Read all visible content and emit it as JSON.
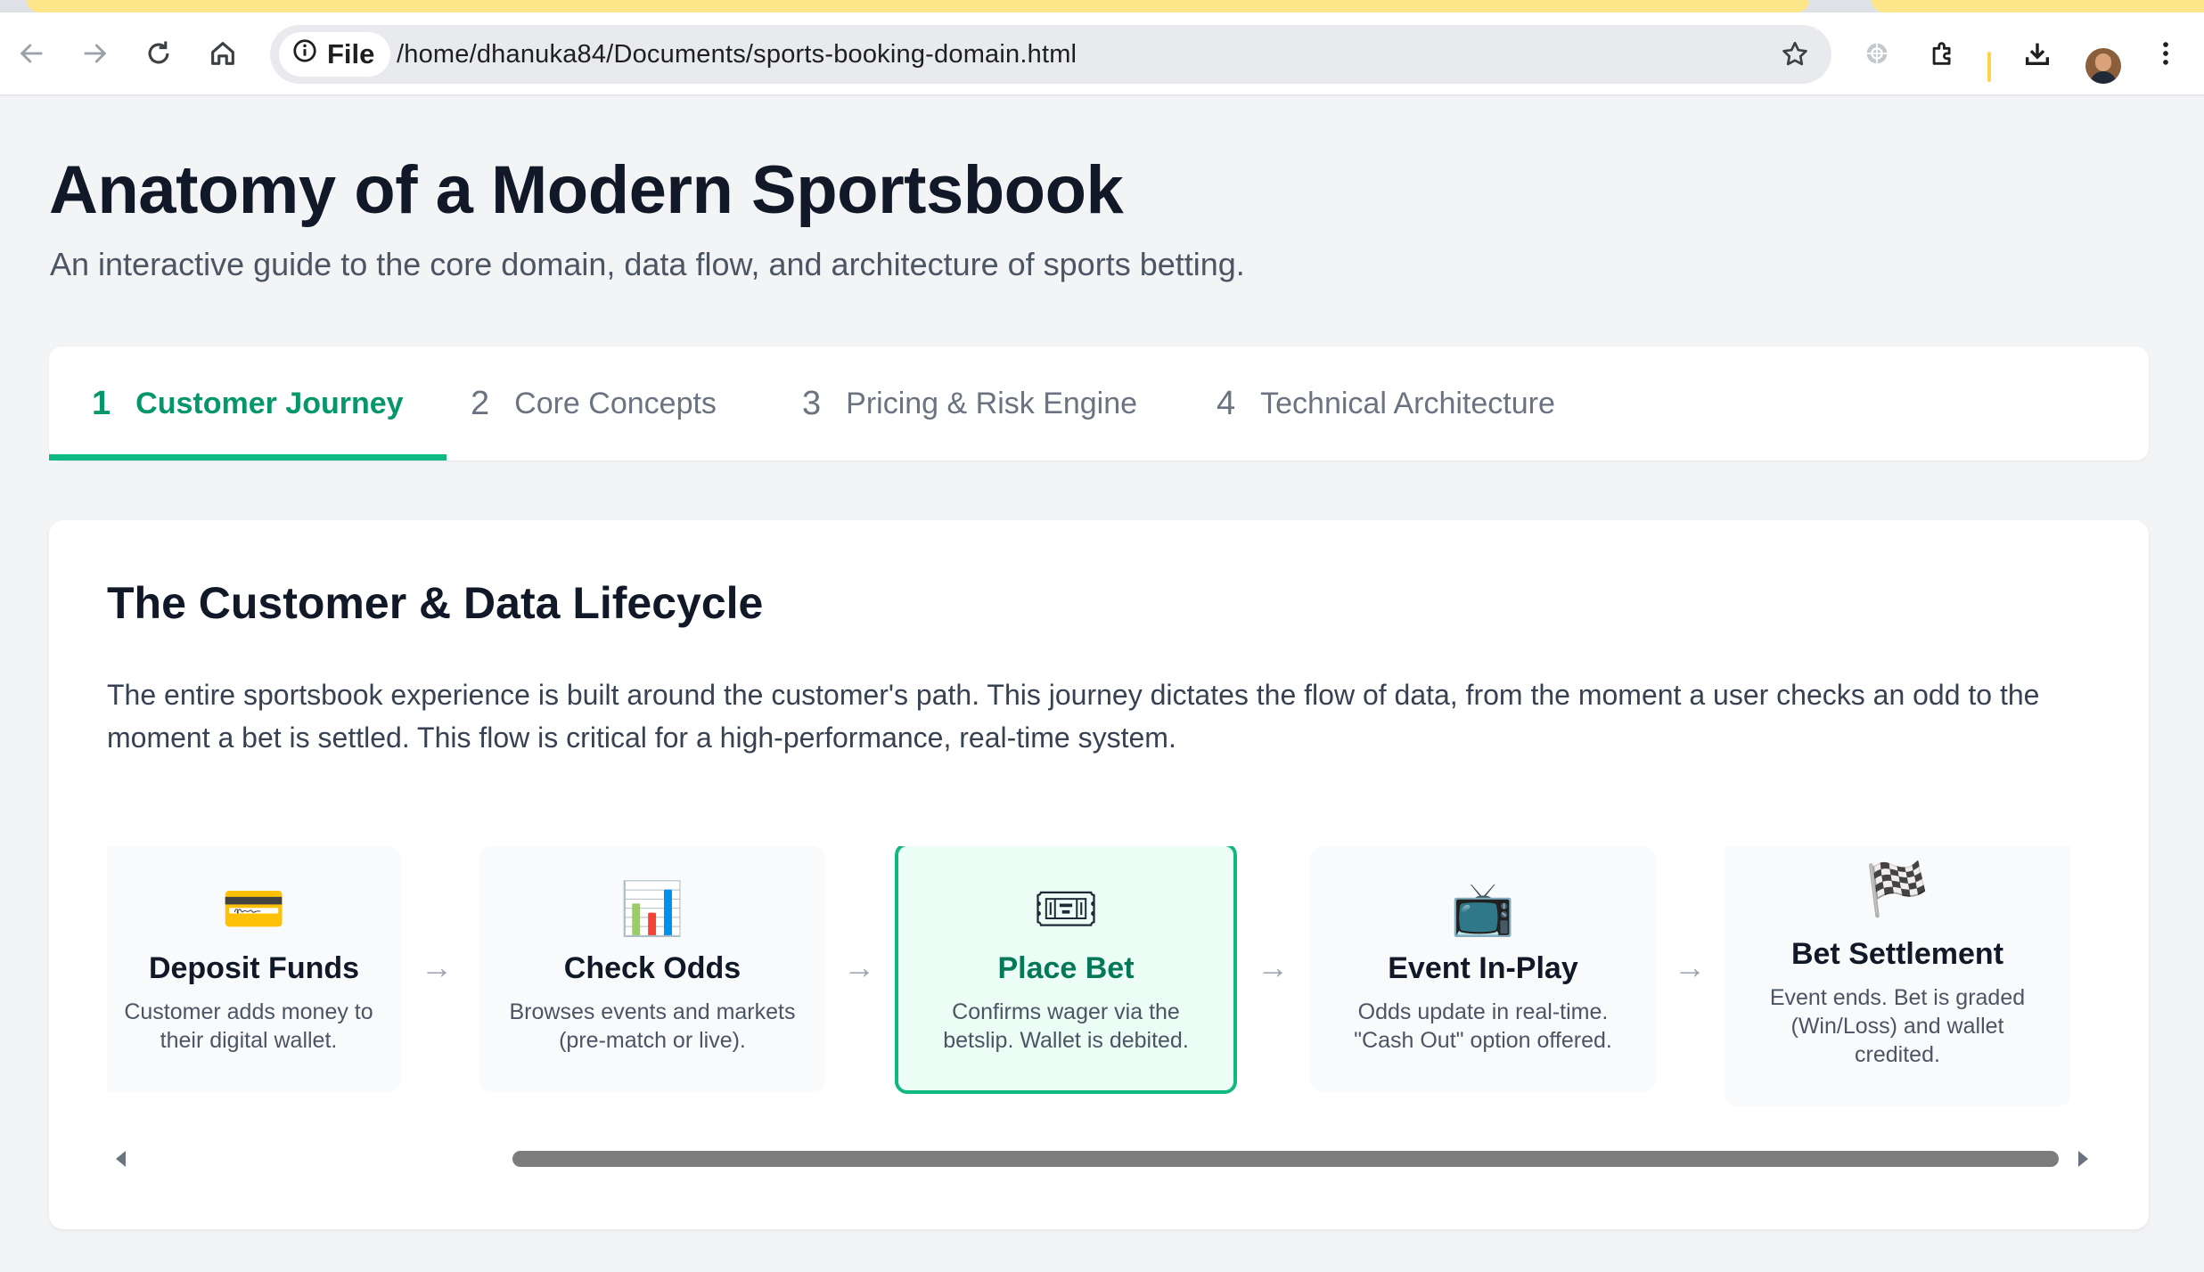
{
  "browser": {
    "url": "/home/dhanuka84/Documents/sports-booking-domain.html",
    "scheme_label": "File",
    "icons": [
      "back-arrow-icon",
      "forward-arrow-icon",
      "reload-icon",
      "home-icon",
      "info-icon",
      "bookmark-star-icon",
      "extension-puzzle-icon",
      "download-icon",
      "kebab-menu-icon"
    ]
  },
  "header": {
    "title": "Anatomy of a Modern Sportsbook",
    "subtitle": "An interactive guide to the core domain, data flow, and architecture of sports betting."
  },
  "tabs": [
    {
      "num": "1",
      "label": "Customer Journey",
      "active": true
    },
    {
      "num": "2",
      "label": "Core Concepts",
      "active": false
    },
    {
      "num": "3",
      "label": "Pricing & Risk Engine",
      "active": false
    },
    {
      "num": "4",
      "label": "Technical Architecture",
      "active": false
    }
  ],
  "section": {
    "title": "The Customer & Data Lifecycle",
    "description": "The entire sportsbook experience is built around the customer's path. This journey dictates the flow of data, from the moment a user checks an odd to the moment a bet is settled. This flow is critical for a high-performance, real-time system."
  },
  "steps": [
    {
      "icon": "💳",
      "icon_name": "credit-card-icon",
      "title": "Deposit Funds",
      "desc": "Customer adds money to their digital wallet."
    },
    {
      "icon": "📊",
      "icon_name": "bar-chart-icon",
      "title": "Check Odds",
      "desc": "Browses events and markets (pre-match or live)."
    },
    {
      "icon": "🎟",
      "icon_name": "ticket-icon",
      "title": "Place Bet",
      "desc": "Confirms wager via the betslip. Wallet is debited."
    },
    {
      "icon": "📺",
      "icon_name": "television-icon",
      "title": "Event In-Play",
      "desc": "Odds update in real-time. \"Cash Out\" option offered."
    },
    {
      "icon": "🏁",
      "icon_name": "checkered-flag-icon",
      "title": "Bet Settlement",
      "desc": "Event ends. Bet is graded (Win/Loss) and wallet credited."
    }
  ],
  "arrow_glyph": "→",
  "colors": {
    "accent": "#10b981",
    "accent_text": "#059669",
    "active_step_bg": "#ecfdf5"
  }
}
